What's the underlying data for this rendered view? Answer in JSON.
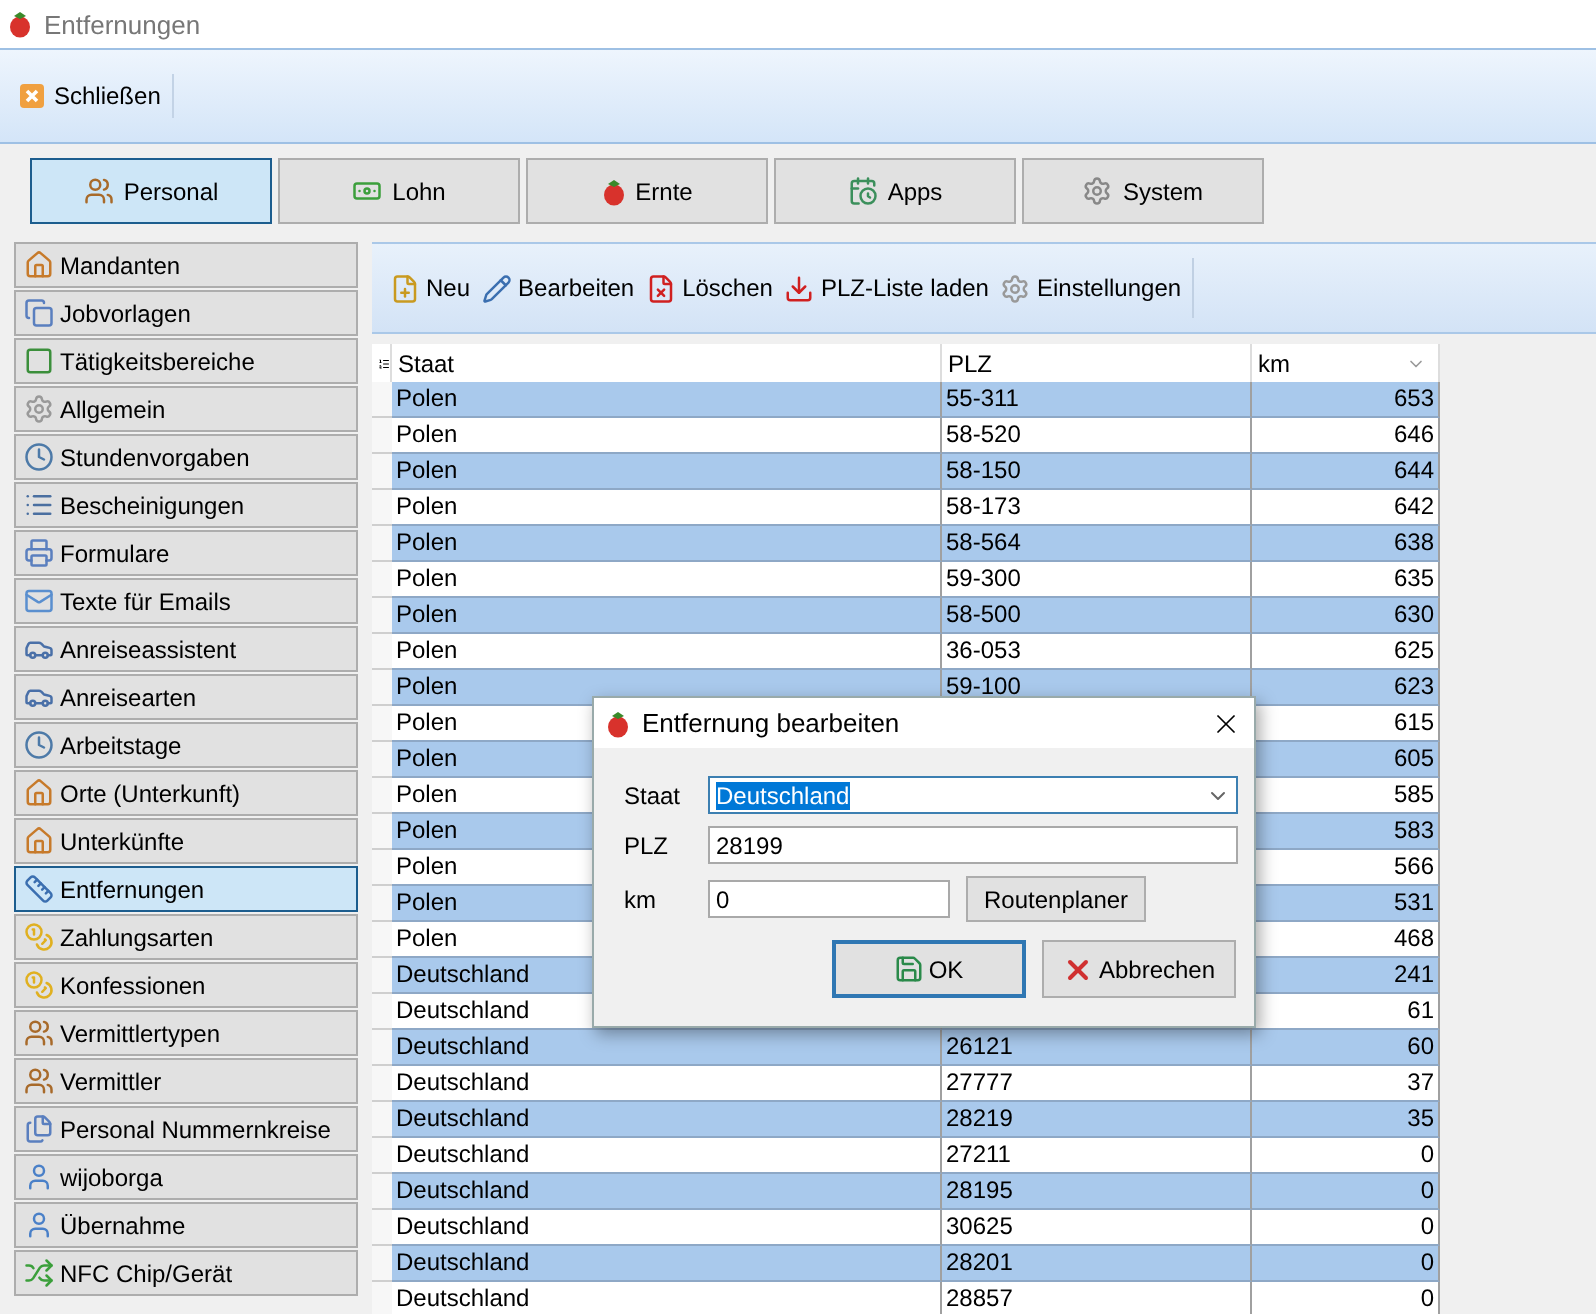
{
  "window": {
    "title": "Entfernungen"
  },
  "ribbon": {
    "buttons": [
      "Schließen"
    ]
  },
  "modules": [
    {
      "label": "Personal",
      "selected": true
    },
    {
      "label": "Lohn",
      "selected": false
    },
    {
      "label": "Ernte",
      "selected": false
    },
    {
      "label": "Apps",
      "selected": false
    },
    {
      "label": "System",
      "selected": false
    }
  ],
  "sidebar": {
    "items": [
      {
        "label": "Mandanten",
        "selected": false
      },
      {
        "label": "Jobvorlagen",
        "selected": false
      },
      {
        "label": "Tätigkeitsbereiche",
        "selected": false
      },
      {
        "label": "Allgemein",
        "selected": false
      },
      {
        "label": "Stundenvorgaben",
        "selected": false
      },
      {
        "label": "Bescheinigungen",
        "selected": false
      },
      {
        "label": "Formulare",
        "selected": false
      },
      {
        "label": "Texte für Emails",
        "selected": false
      },
      {
        "label": "Anreiseassistent",
        "selected": false
      },
      {
        "label": "Anreisearten",
        "selected": false
      },
      {
        "label": "Arbeitstage",
        "selected": false
      },
      {
        "label": "Orte (Unterkunft)",
        "selected": false
      },
      {
        "label": "Unterkünfte",
        "selected": false
      },
      {
        "label": "Entfernungen",
        "selected": true
      },
      {
        "label": "Zahlungsarten",
        "selected": false
      },
      {
        "label": "Konfessionen",
        "selected": false
      },
      {
        "label": "Vermittlertypen",
        "selected": false
      },
      {
        "label": "Vermittler",
        "selected": false
      },
      {
        "label": "Personal Nummernkreise",
        "selected": false
      },
      {
        "label": "wijoborga",
        "selected": false
      },
      {
        "label": "Übernahme",
        "selected": false
      },
      {
        "label": "NFC Chip/Gerät",
        "selected": false
      }
    ]
  },
  "toolbar": {
    "buttons": [
      "Neu",
      "Bearbeiten",
      "Löschen",
      "PLZ-Liste laden",
      "Einstellungen"
    ]
  },
  "table": {
    "columns": [
      "Staat",
      "PLZ",
      "km"
    ],
    "rows": [
      {
        "staat": "Polen",
        "plz": "55-311",
        "km": "653"
      },
      {
        "staat": "Polen",
        "plz": "58-520",
        "km": "646"
      },
      {
        "staat": "Polen",
        "plz": "58-150",
        "km": "644"
      },
      {
        "staat": "Polen",
        "plz": "58-173",
        "km": "642"
      },
      {
        "staat": "Polen",
        "plz": "58-564",
        "km": "638"
      },
      {
        "staat": "Polen",
        "plz": "59-300",
        "km": "635"
      },
      {
        "staat": "Polen",
        "plz": "58-500",
        "km": "630"
      },
      {
        "staat": "Polen",
        "plz": "36-053",
        "km": "625"
      },
      {
        "staat": "Polen",
        "plz": "59-100",
        "km": "623"
      },
      {
        "staat": "Polen",
        "km": "615"
      },
      {
        "staat": "Polen",
        "km": "605"
      },
      {
        "staat": "Polen",
        "km": "585"
      },
      {
        "staat": "Polen",
        "km": "583"
      },
      {
        "staat": "Polen",
        "km": "566"
      },
      {
        "staat": "Polen",
        "km": "531"
      },
      {
        "staat": "Polen",
        "km": "468"
      },
      {
        "staat": "Deutschland",
        "km": "241"
      },
      {
        "staat": "Deutschland",
        "km": "61"
      },
      {
        "staat": "Deutschland",
        "plz": "26121",
        "km": "60"
      },
      {
        "staat": "Deutschland",
        "plz": "27777",
        "km": "37"
      },
      {
        "staat": "Deutschland",
        "plz": "28219",
        "km": "35"
      },
      {
        "staat": "Deutschland",
        "plz": "27211",
        "km": "0"
      },
      {
        "staat": "Deutschland",
        "plz": "28195",
        "km": "0"
      },
      {
        "staat": "Deutschland",
        "plz": "30625",
        "km": "0"
      },
      {
        "staat": "Deutschland",
        "plz": "28201",
        "km": "0"
      },
      {
        "staat": "Deutschland",
        "plz": "28857",
        "km": "0"
      }
    ]
  },
  "dialog": {
    "title": "Entfernung bearbeiten",
    "fields": [
      {
        "label": "Staat",
        "value": "Deutschland",
        "kind": "combo"
      },
      {
        "label": "PLZ",
        "value": "28199",
        "kind": "text"
      },
      {
        "label": "km",
        "value": "0",
        "kind": "short"
      }
    ],
    "route_button": "Routenplaner",
    "buttons": [
      "OK",
      "Abbrechen"
    ]
  }
}
